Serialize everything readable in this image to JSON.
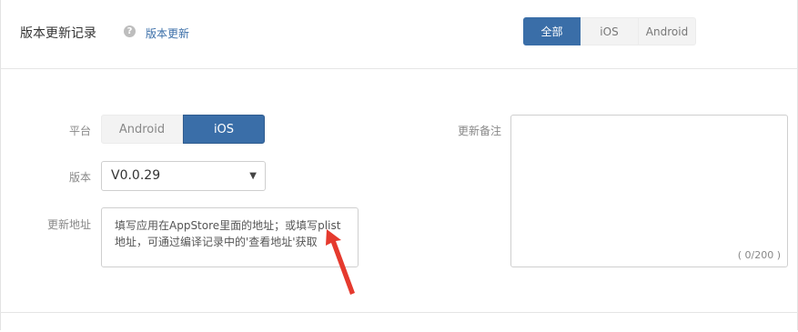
{
  "header": {
    "title": "版本更新记录",
    "help_icon": "question-circle-icon",
    "help_link": "版本更新"
  },
  "filter_tabs": [
    "全部",
    "iOS",
    "Android"
  ],
  "form": {
    "platform_label": "平台",
    "platform_options": [
      "Android",
      "iOS"
    ],
    "version_label": "版本",
    "version_value": "V0.0.29",
    "url_label": "更新地址",
    "url_placeholder_line1": "填写应用在AppStore里面的地址；或填写plist",
    "url_placeholder_line2": "地址，可通过编译记录中的'查看地址'获取",
    "notes_label": "更新备注",
    "notes_counter": "( 0/200 )"
  },
  "colors": {
    "accent": "#3a6ea8",
    "annotation_arrow": "#e53a2e"
  }
}
